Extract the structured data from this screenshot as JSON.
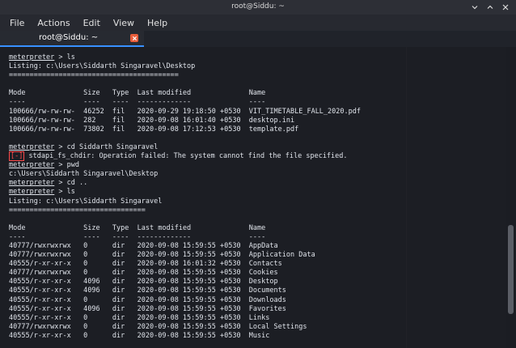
{
  "window": {
    "title": "root@Siddu: ~"
  },
  "menu": [
    "File",
    "Actions",
    "Edit",
    "View",
    "Help"
  ],
  "tab": {
    "label": "root@Siddu: ~"
  },
  "terminal": {
    "l1_prompt": "meterpreter",
    "l1_rest": " > ls",
    "l2": "Listing: c:\\Users\\Siddarth Singaravel\\Desktop",
    "l3": "=========================================",
    "l4": "",
    "l5": "Mode              Size   Type  Last modified              Name",
    "l6": "----              ----   ----  -------------              ----",
    "l7": "100666/rw-rw-rw-  46252  fil   2020-09-29 19:18:50 +0530  VIT_TIMETABLE_FALL_2020.pdf",
    "l8": "100666/rw-rw-rw-  282    fil   2020-09-08 16:01:40 +0530  desktop.ini",
    "l9": "100666/rw-rw-rw-  73802  fil   2020-09-08 17:12:53 +0530  template.pdf",
    "l10": "",
    "l11_prompt": "meterpreter",
    "l11_rest": " > cd Siddarth Singaravel",
    "l12_mark": "[-]",
    "l12_rest": " stdapi_fs_chdir: Operation failed: The system cannot find the file specified.",
    "l13_prompt": "meterpreter",
    "l13_rest": " > pwd",
    "l14": "c:\\Users\\Siddarth Singaravel\\Desktop",
    "l15_prompt": "meterpreter",
    "l15_rest": " > cd ..",
    "l16_prompt": "meterpreter",
    "l16_rest": " > ls",
    "l17": "Listing: c:\\Users\\Siddarth Singaravel",
    "l18": "=================================",
    "l19": "",
    "l20": "Mode              Size   Type  Last modified              Name",
    "l21": "----              ----   ----  -------------              ----",
    "l22": "40777/rwxrwxrwx   0      dir   2020-09-08 15:59:55 +0530  AppData",
    "l23": "40777/rwxrwxrwx   0      dir   2020-09-08 15:59:55 +0530  Application Data",
    "l24": "40555/r-xr-xr-x   0      dir   2020-09-08 16:01:32 +0530  Contacts",
    "l25": "40777/rwxrwxrwx   0      dir   2020-09-08 15:59:55 +0530  Cookies",
    "l26": "40555/r-xr-xr-x   4096   dir   2020-09-08 15:59:55 +0530  Desktop",
    "l27": "40555/r-xr-xr-x   4096   dir   2020-09-08 15:59:55 +0530  Documents",
    "l28": "40555/r-xr-xr-x   0      dir   2020-09-08 15:59:55 +0530  Downloads",
    "l29": "40555/r-xr-xr-x   4096   dir   2020-09-08 15:59:55 +0530  Favorites",
    "l30": "40555/r-xr-xr-x   0      dir   2020-09-08 15:59:55 +0530  Links",
    "l31": "40777/rwxrwxrwx   0      dir   2020-09-08 15:59:55 +0530  Local Settings",
    "l32": "40555/r-xr-xr-x   0      dir   2020-09-08 15:59:55 +0530  Music"
  },
  "colors": {
    "error": "#ff4a4a",
    "accent": "#3891ff",
    "close": "#e85d3b"
  }
}
